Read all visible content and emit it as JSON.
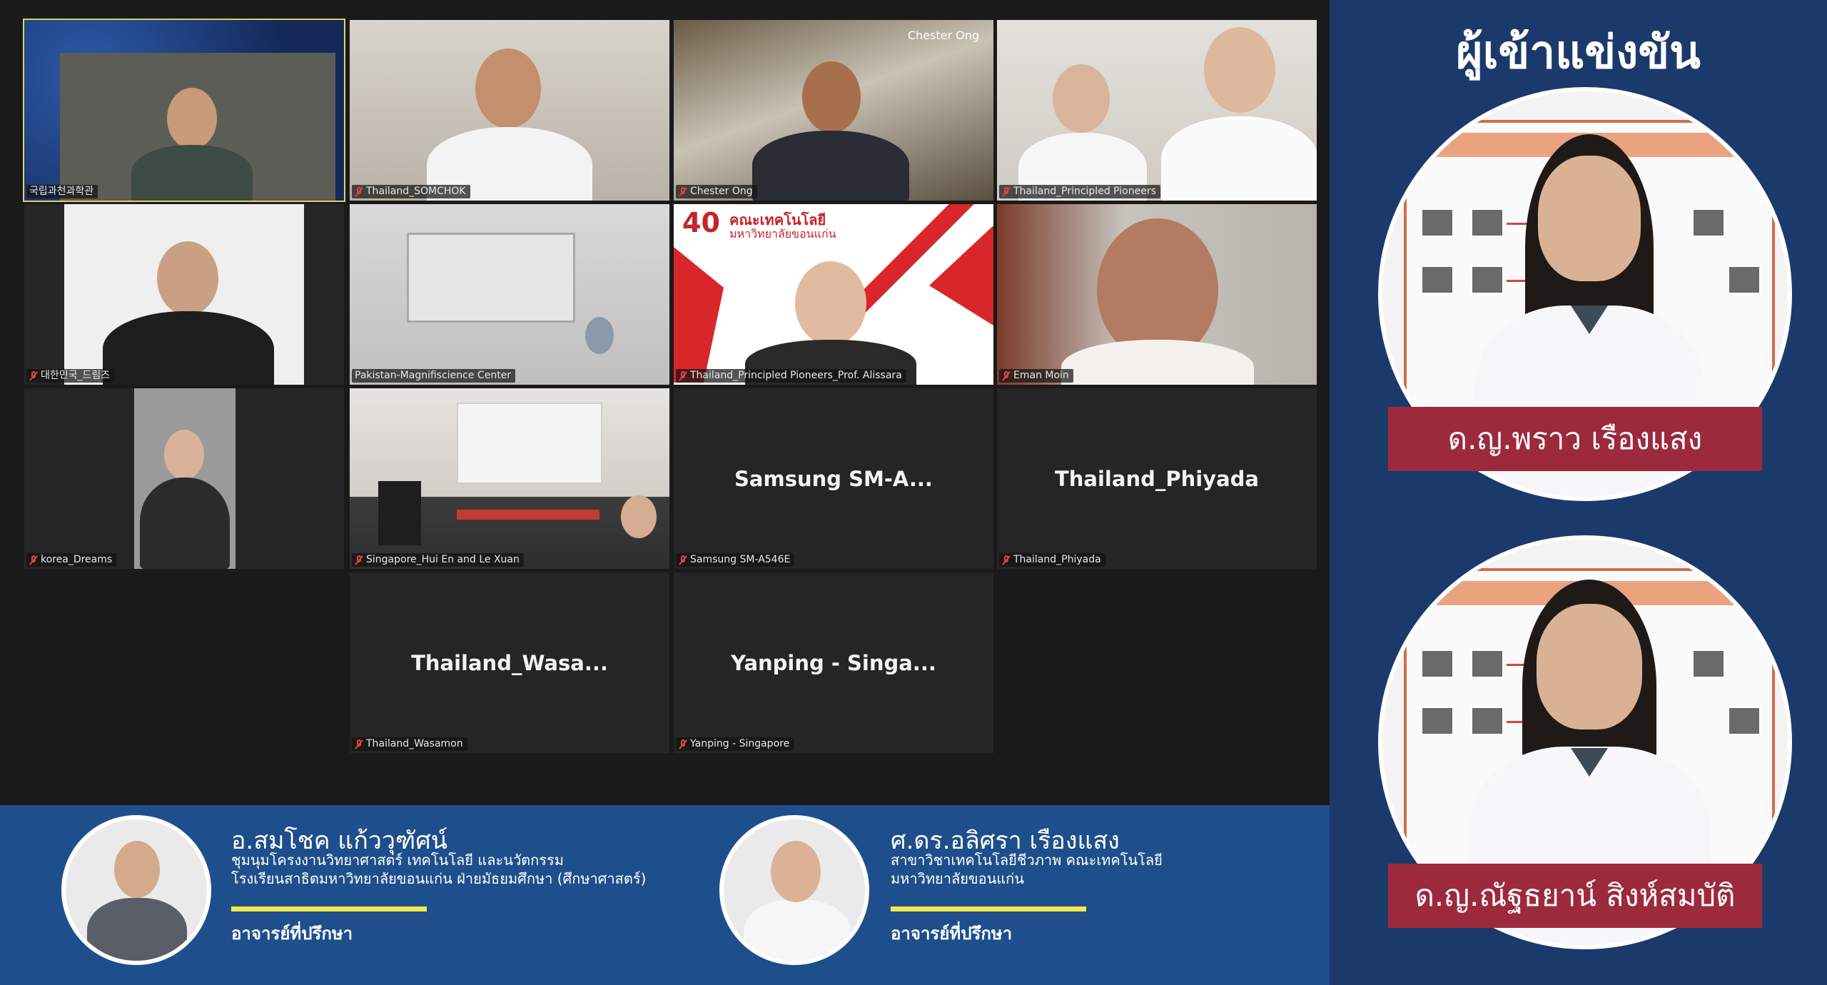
{
  "meeting": {
    "participants": [
      {
        "name": "국립과천과학관",
        "muted": false,
        "video": true
      },
      {
        "name": "Thailand_SOMCHOK",
        "muted": true,
        "video": true
      },
      {
        "name": "Chester Ong",
        "muted": true,
        "video": true,
        "overlay_name": "Chester Ong"
      },
      {
        "name": "Thailand_Principled Pioneers",
        "muted": true,
        "video": true
      },
      {
        "name": "대한민국_드림즈",
        "muted": true,
        "video": true
      },
      {
        "name": "Pakistan-Magnifiscience Center",
        "muted": false,
        "video": true
      },
      {
        "name": "Thailand_Principled Pioneers_Prof. Alissara",
        "muted": true,
        "video": true
      },
      {
        "name": "Eman Moin",
        "muted": true,
        "video": true
      },
      {
        "name": "korea_Dreams",
        "muted": true,
        "video": true
      },
      {
        "name": "Singapore_Hui En and Le Xuan",
        "muted": true,
        "video": true
      },
      {
        "name": "Samsung SM-A546E",
        "display_name": "Samsung  SM-A...",
        "muted": true,
        "video": false
      },
      {
        "name": "Thailand_Phiyada",
        "display_name": "Thailand_Phiyada",
        "muted": true,
        "video": false
      },
      {
        "name": "Thailand_Wasamon",
        "display_name": "Thailand_Wasa...",
        "muted": true,
        "video": false
      },
      {
        "name": "Yanping - Singapore",
        "display_name": "Yanping  -  Singa...",
        "muted": true,
        "video": false
      }
    ],
    "slide_header_text": "คณะเทคโนโลยี",
    "slide_subheader_text": "มหาวิทยาลัยขอนแก่น",
    "slide_anniversary": "40"
  },
  "advisors": [
    {
      "name": "อ.สมโชค แก้ววุฑัศน์",
      "line1": "ชุมนุมโครงงานวิทยาศาสตร์ เทคโนโลยี และนวัตกรรม",
      "line2": "โรงเรียนสาธิตมหาวิทยาลัยขอนแก่น ฝ่ายมัธยมศึกษา (ศึกษาศาสตร์)",
      "role": "อาจารย์ที่ปรึกษา"
    },
    {
      "name": "ศ.ดร.อลิศรา เรืองแสง",
      "line1": "สาขาวิชาเทคโนโลยีชีวภาพ คณะเทคโนโลยี",
      "line2": "มหาวิทยาลัยขอนแก่น",
      "role": "อาจารย์ที่ปรึกษา"
    }
  ],
  "contestants": {
    "title": "ผู้เข้าแข่งขัน",
    "people": [
      {
        "name": "ด.ญ.พราว เรืองแสง"
      },
      {
        "name": "ด.ญ.ณัฐธยาน์ สิงห์สมบัติ"
      }
    ]
  },
  "colors": {
    "meeting_bg": "#1a1a1a",
    "tile_bg": "#252525",
    "advisor_bar": "#1e4f8c",
    "right_panel": "#1b3a6b",
    "banner": "#9c2a3c",
    "underline": "#f2e94e",
    "active_speaker_border": "#d9d36a",
    "muted_icon": "#e0453d"
  }
}
